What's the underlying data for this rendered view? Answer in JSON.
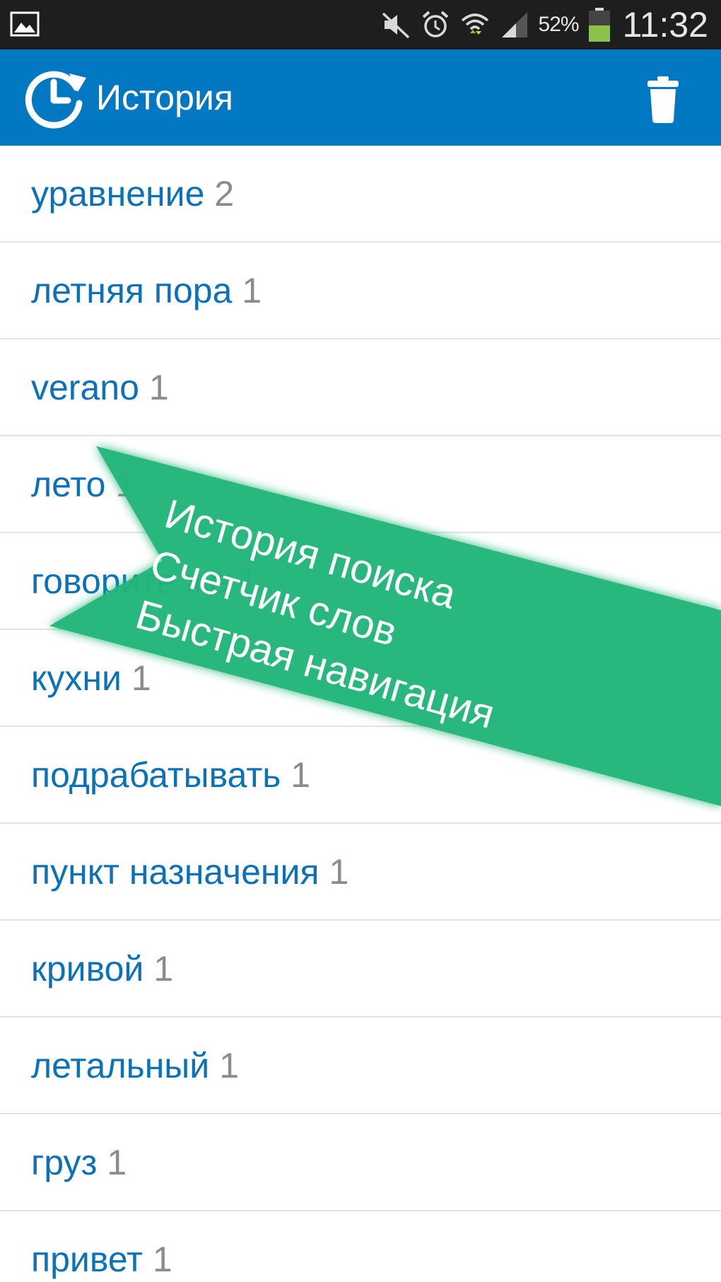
{
  "status_bar": {
    "battery_percent": "52%",
    "time": "11:32",
    "icons": [
      "gallery-icon",
      "mute-icon",
      "alarm-icon",
      "wifi-icon",
      "signal-icon",
      "battery-icon"
    ]
  },
  "app_bar": {
    "title": "История",
    "logo_icon": "history-refresh-icon",
    "action_icon": "trash-icon",
    "color": "#0277c2"
  },
  "history": [
    {
      "word": "уравнение",
      "count": "2"
    },
    {
      "word": "летняя пора",
      "count": "1"
    },
    {
      "word": "verano",
      "count": "1"
    },
    {
      "word": "лето",
      "count": "1"
    },
    {
      "word": "говорите же",
      "count": "1"
    },
    {
      "word": "кухни",
      "count": "1"
    },
    {
      "word": "подрабатывать",
      "count": "1"
    },
    {
      "word": "пункт назначения",
      "count": "1"
    },
    {
      "word": "кривой",
      "count": "1"
    },
    {
      "word": "летальный",
      "count": "1"
    },
    {
      "word": "груз",
      "count": "1"
    },
    {
      "word": "привет",
      "count": "1"
    }
  ],
  "banner": {
    "lines": [
      "История поиска",
      "Счетчик слов",
      "Быстрая навигация"
    ],
    "color": "#22b67a"
  },
  "colors": {
    "word": "#0b72b9",
    "count": "#8c8c8c",
    "divider": "#e2e2e2"
  }
}
